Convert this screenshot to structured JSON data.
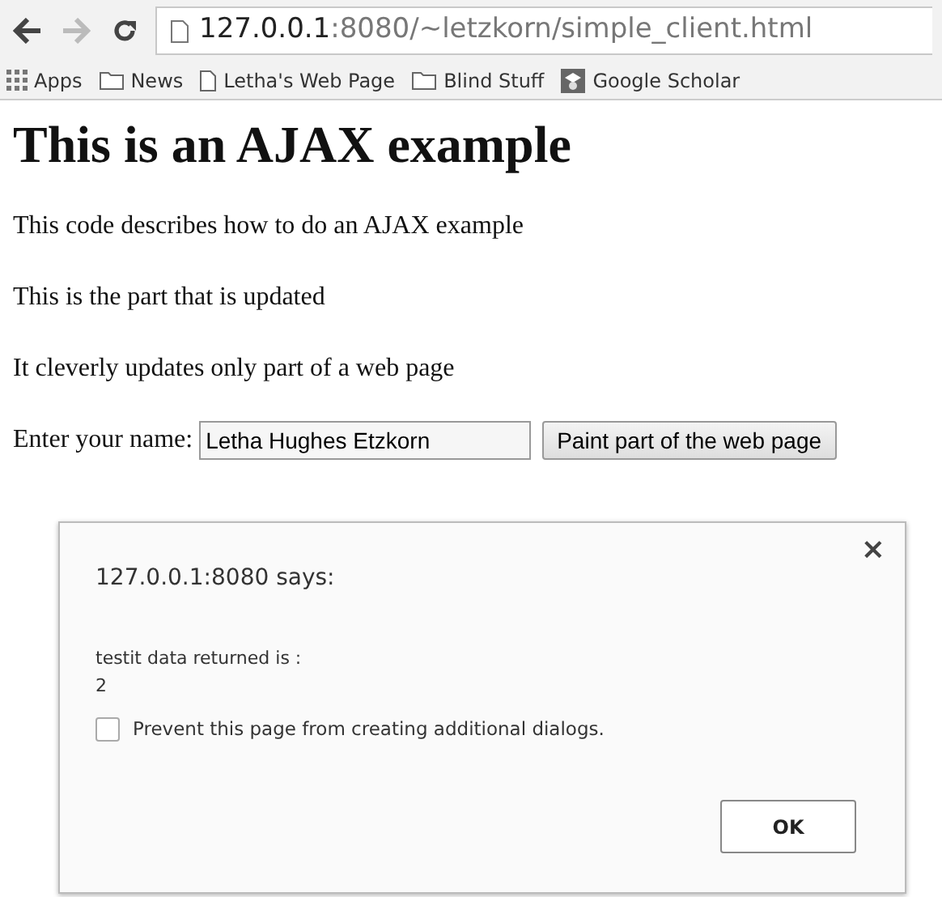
{
  "browser": {
    "back_enabled": true,
    "forward_enabled": false,
    "address": {
      "host": "127.0.0.1",
      "rest": ":8080/~letzkorn/simple_client.html"
    },
    "bookmarks": [
      {
        "kind": "apps",
        "label": "Apps"
      },
      {
        "kind": "folder",
        "label": "News"
      },
      {
        "kind": "page",
        "label": "Letha's Web Page"
      },
      {
        "kind": "folder",
        "label": "Blind Stuff"
      },
      {
        "kind": "scholar",
        "label": "Google Scholar"
      }
    ]
  },
  "page": {
    "heading": "This is an AJAX example",
    "paragraphs": [
      "This code describes how to do an AJAX example",
      "This is the part that is updated",
      "It cleverly updates only part of a web page"
    ],
    "name_label": "Enter your name:",
    "name_value": "Letha Hughes Etzkorn",
    "button": "Paint part of the web page"
  },
  "dialog": {
    "title": "127.0.0.1:8080 says:",
    "close": "×",
    "message_lines": [
      "testit data returned is :",
      "2"
    ],
    "checkbox": {
      "label": "Prevent this page from creating additional dialogs.",
      "checked": false
    },
    "ok": "OK"
  }
}
